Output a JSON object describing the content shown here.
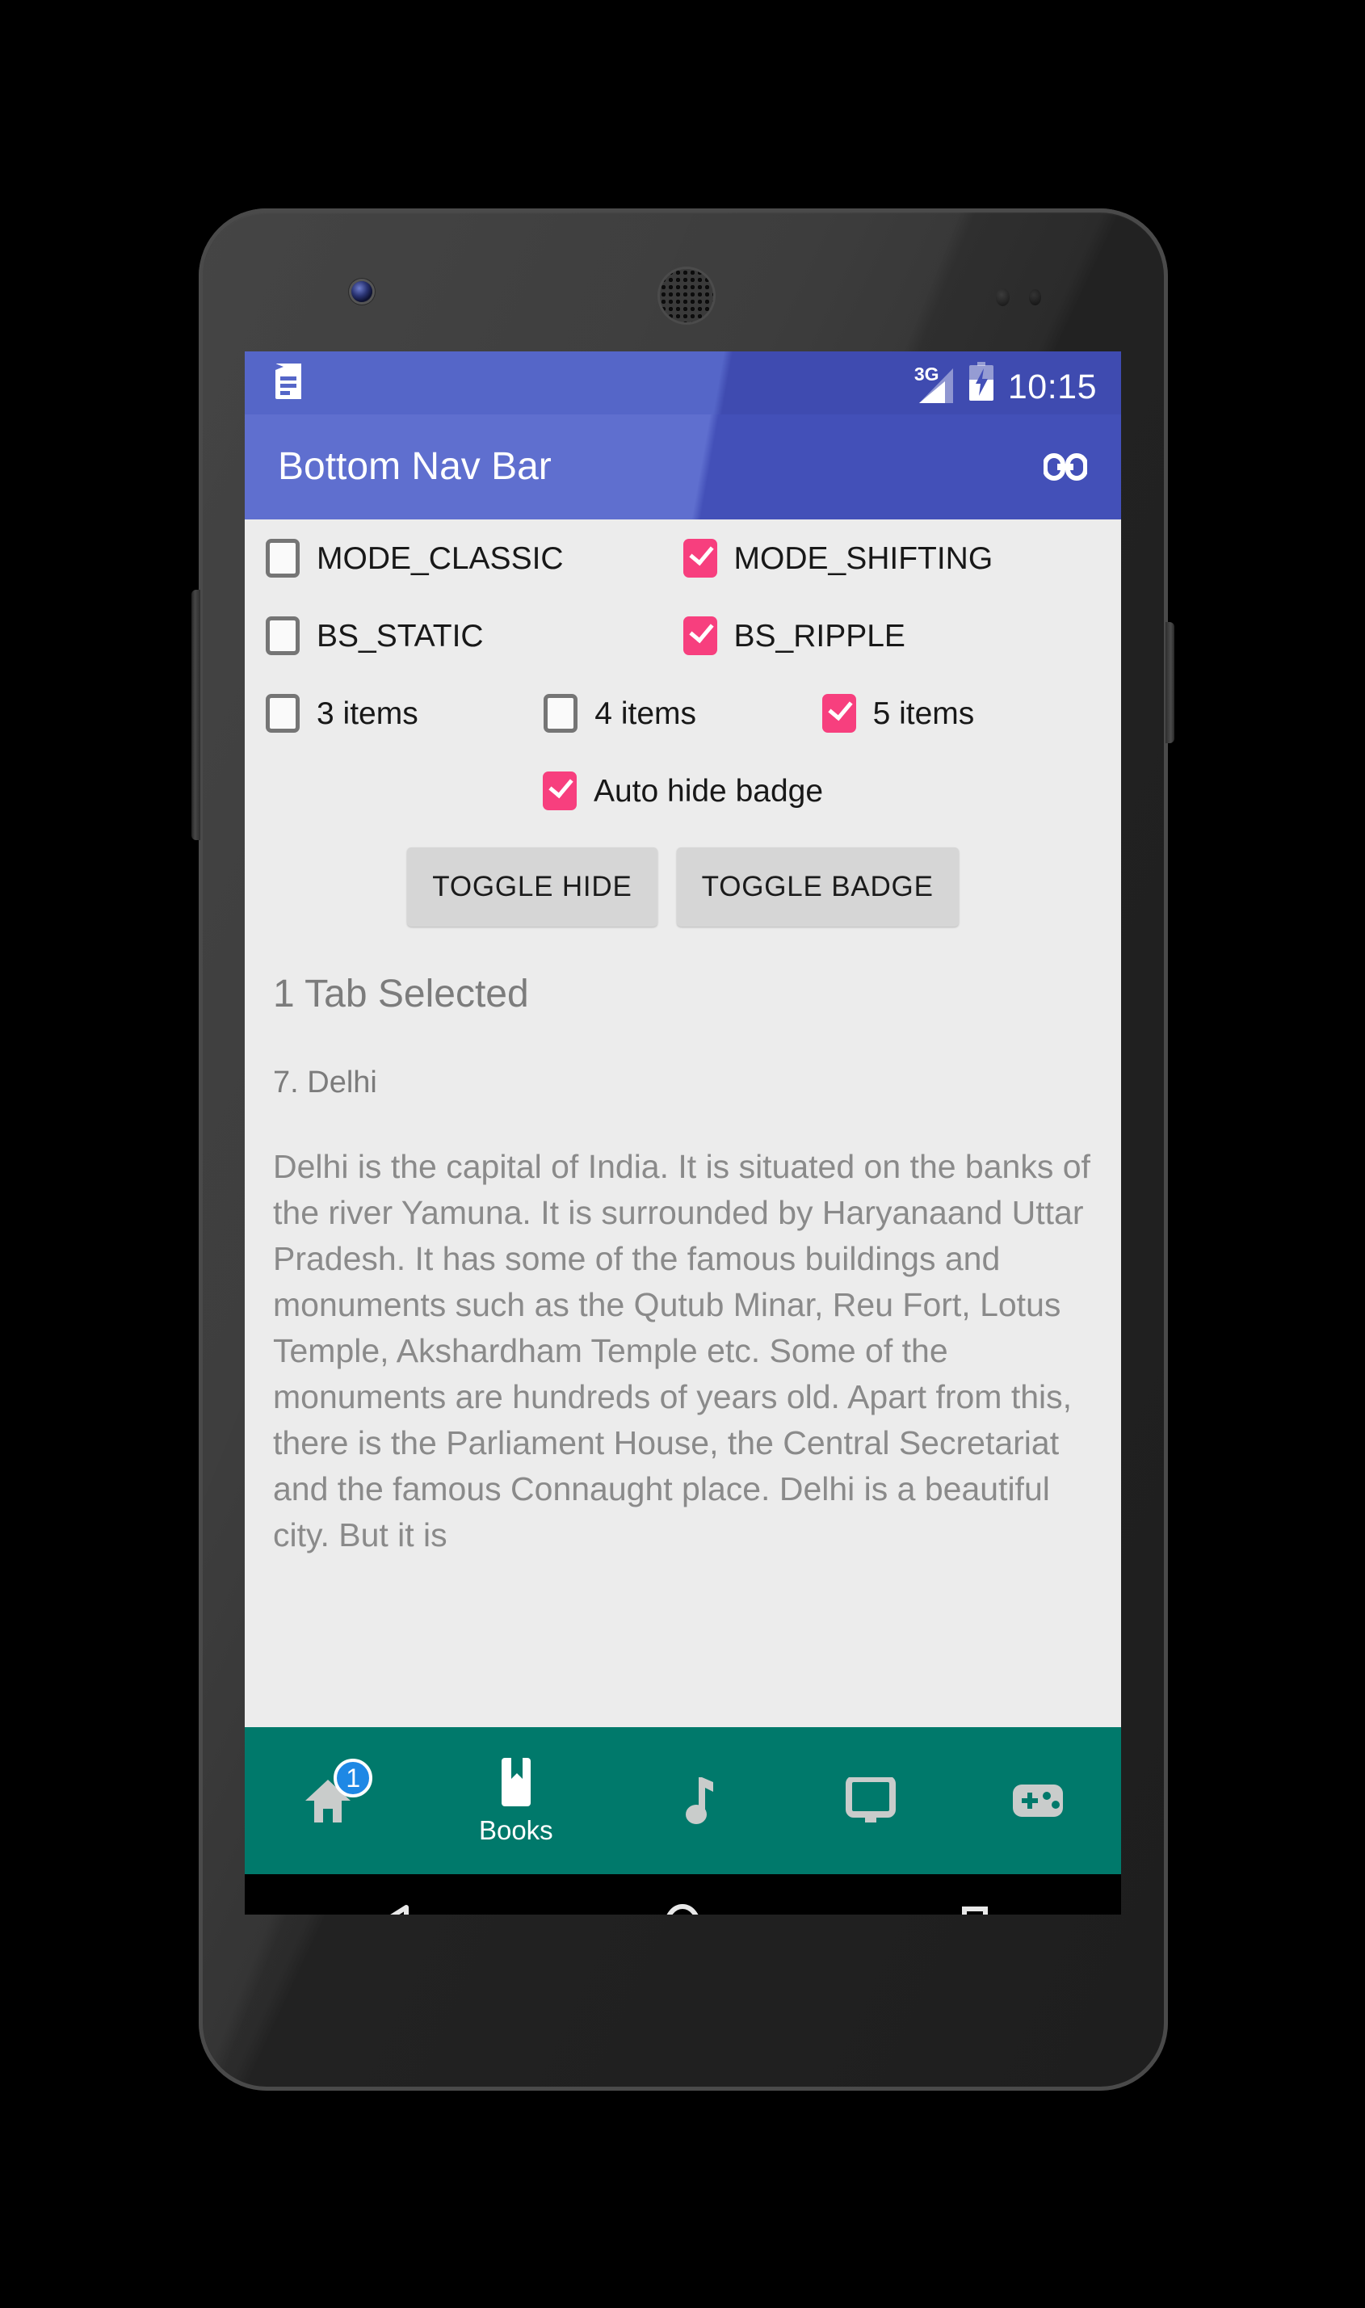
{
  "status_bar": {
    "notification_icon": "document-notification-icon",
    "network_label": "3G",
    "signal_icon": "signal-bars-icon",
    "battery_icon": "battery-charging-icon",
    "clock": "10:15"
  },
  "app_bar": {
    "title": "Bottom Nav Bar",
    "action_icon": "link-icon"
  },
  "options": {
    "rows": [
      [
        {
          "label": "MODE_CLASSIC",
          "checked": false
        },
        {
          "label": "MODE_SHIFTING",
          "checked": true
        }
      ],
      [
        {
          "label": "BS_STATIC",
          "checked": false
        },
        {
          "label": "BS_RIPPLE",
          "checked": true
        }
      ],
      [
        {
          "label": "3 items",
          "checked": false
        },
        {
          "label": "4 items",
          "checked": false
        },
        {
          "label": "5 items",
          "checked": true
        }
      ],
      [
        {
          "label": "Auto hide badge",
          "checked": true
        }
      ]
    ],
    "checked_color": "#F73F7E",
    "unchecked_border_color": "#757575"
  },
  "buttons": {
    "toggle_hide": "TOGGLE HIDE",
    "toggle_badge": "TOGGLE BADGE"
  },
  "content": {
    "tab_selected": "1 Tab Selected",
    "heading": "7. Delhi",
    "body": "Delhi is the capital of India. It is situated on the banks of the river Yamuna. It is surrounded by Haryanaand Uttar Pradesh. It has some of the famous buildings and monuments such as the Qutub Minar, Reu Fort, Lotus Temple, Akshardham Temple etc. Some of the monuments are hundreds of years old. Apart from this, there is the Parliament House, the Central Secretariat and the famous Connaught place. Delhi is a beautiful city. But it is"
  },
  "bottom_nav": {
    "background_color": "#00796B",
    "badge_color": "#1E88E5",
    "items": [
      {
        "icon": "home-icon",
        "label": "",
        "selected": false,
        "badge": "1"
      },
      {
        "icon": "book-icon",
        "label": "Books",
        "selected": true,
        "badge": ""
      },
      {
        "icon": "music-note-icon",
        "label": "",
        "selected": false,
        "badge": ""
      },
      {
        "icon": "tv-monitor-icon",
        "label": "",
        "selected": false,
        "badge": ""
      },
      {
        "icon": "gamepad-icon",
        "label": "",
        "selected": false,
        "badge": ""
      }
    ]
  },
  "system_nav": {
    "back": "back-triangle-icon",
    "home": "home-circle-icon",
    "recents": "recents-square-icon"
  }
}
